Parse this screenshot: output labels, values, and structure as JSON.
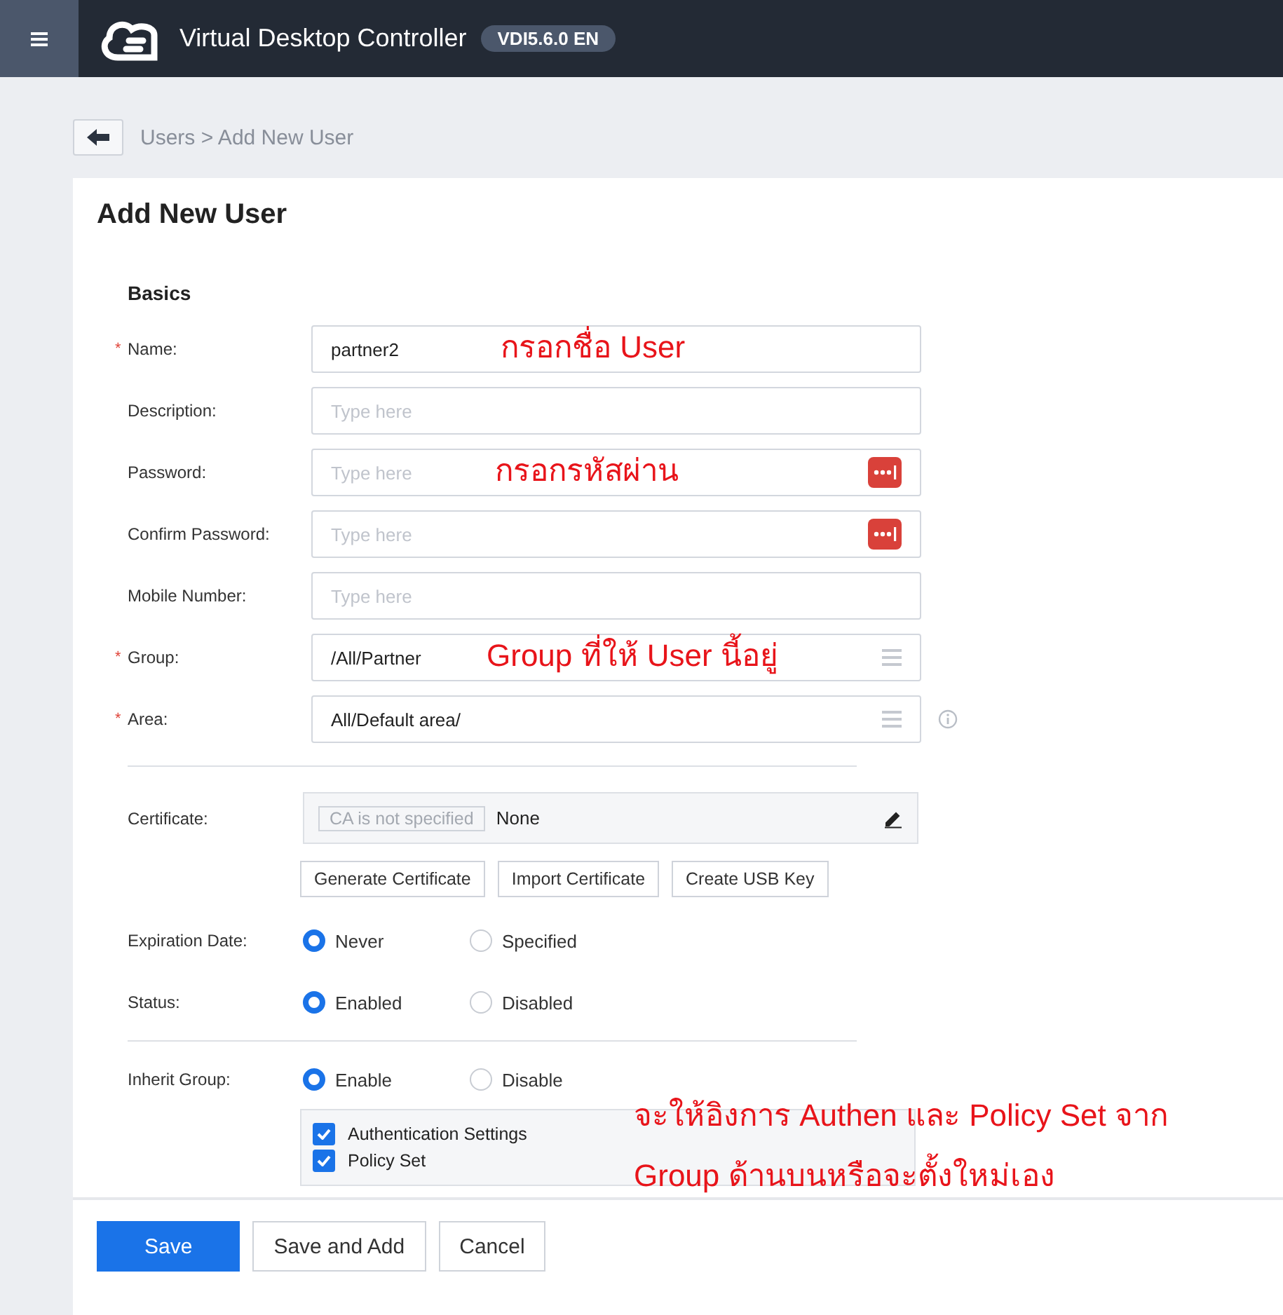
{
  "header": {
    "title": "Virtual Desktop Controller",
    "version": "VDI5.6.0 EN"
  },
  "breadcrumb": "Users > Add New User",
  "page_title": "Add New User",
  "section": "Basics",
  "fields": [
    {
      "label": "Name:",
      "marker": "*",
      "kind": "text",
      "value": "partner2",
      "annotation": "กรอกชื่อ User"
    },
    {
      "label": "Description:",
      "kind": "text",
      "placeholder": "Type here"
    },
    {
      "label": "Password:",
      "kind": "password",
      "placeholder": "Type here",
      "annotation": "กรอกรหัสผ่าน"
    },
    {
      "label": "Confirm Password:",
      "kind": "password",
      "placeholder": "Type here"
    },
    {
      "label": "Mobile Number:",
      "kind": "text",
      "placeholder": "Type here"
    },
    {
      "label": "Group:",
      "marker": "*",
      "kind": "select",
      "value": "/All/Partner",
      "annotation": "Group ที่ให้ User นี้อยู่"
    },
    {
      "label": "Area:",
      "marker": "*",
      "kind": "select",
      "value": "All/Default area/",
      "info": true
    }
  ],
  "certificate": {
    "label": "Certificate:",
    "tag": "CA is not specified",
    "value": "None",
    "buttons": [
      "Generate Certificate",
      "Import Certificate",
      "Create USB Key"
    ]
  },
  "radio_groups": [
    {
      "label": "Expiration Date:",
      "options": [
        {
          "label": "Never",
          "selected": true
        },
        {
          "label": "Specified",
          "selected": false
        }
      ]
    },
    {
      "label": "Status:",
      "options": [
        {
          "label": "Enabled",
          "selected": true
        },
        {
          "label": "Disabled",
          "selected": false
        }
      ]
    }
  ],
  "inherit": {
    "label": "Inherit Group:",
    "options": [
      {
        "label": "Enable",
        "selected": true
      },
      {
        "label": "Disable",
        "selected": false
      }
    ],
    "checks": [
      {
        "label": "Authentication Settings",
        "checked": true
      },
      {
        "label": "Policy Set",
        "checked": true
      }
    ]
  },
  "buttons": [
    {
      "label": "Save",
      "primary": true
    },
    {
      "label": "Save and Add",
      "primary": false
    },
    {
      "label": "Cancel",
      "primary": false
    }
  ],
  "annotations": [
    "จะให้อิงการ Authen และ Policy Set จาก",
    "Group ด้านบนหรือจะตั้งใหม่เอง"
  ]
}
